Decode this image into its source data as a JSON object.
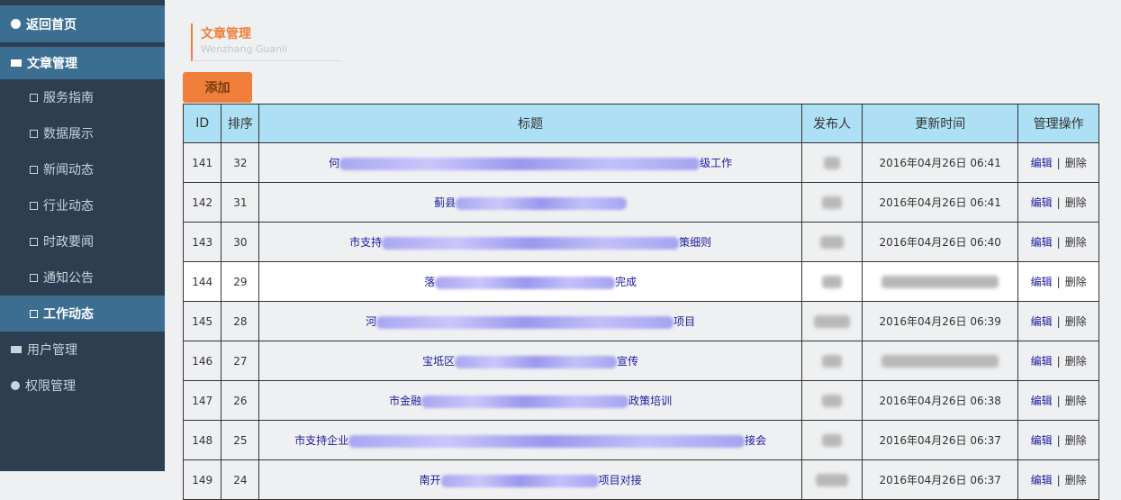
{
  "sidebar": {
    "home": "返回首页",
    "article_section": "文章管理",
    "items": [
      {
        "label": "服务指南",
        "active": false
      },
      {
        "label": "数据展示",
        "active": false
      },
      {
        "label": "新闻动态",
        "active": false
      },
      {
        "label": "行业动态",
        "active": false
      },
      {
        "label": "时政要闻",
        "active": false
      },
      {
        "label": "通知公告",
        "active": false
      },
      {
        "label": "工作动态",
        "active": true
      }
    ],
    "user_mgmt": "用户管理",
    "perm_mgmt": "权限管理"
  },
  "header": {
    "title": "文章管理",
    "subtitle": "Wenzhang Guanli"
  },
  "toolbar": {
    "add_label": "添加"
  },
  "table": {
    "columns": [
      "ID",
      "排序",
      "标题",
      "发布人",
      "更新时间",
      "管理操作"
    ],
    "edit_label": "编辑",
    "sep": "|",
    "delete_label": "删除",
    "rows": [
      {
        "id": "141",
        "sort": "32",
        "title_start": "何",
        "title_end": "级工作",
        "time": "2016年04月26日 06:41"
      },
      {
        "id": "142",
        "sort": "31",
        "title_start": "蓟县",
        "title_end": "",
        "time": "2016年04月26日 06:41"
      },
      {
        "id": "143",
        "sort": "30",
        "title_start": "市支持",
        "title_end": "策细则",
        "time": "2016年04月26日 06:40"
      },
      {
        "id": "144",
        "sort": "29",
        "title_start": "落",
        "title_end": "完成",
        "time": ""
      },
      {
        "id": "145",
        "sort": "28",
        "title_start": "河",
        "title_end": "项目",
        "time": "2016年04月26日 06:39"
      },
      {
        "id": "146",
        "sort": "27",
        "title_start": "宝坻区",
        "title_end": "宣传",
        "time": ""
      },
      {
        "id": "147",
        "sort": "26",
        "title_start": "市金融",
        "title_end": "政策培训",
        "time": "2016年04月26日 06:38"
      },
      {
        "id": "148",
        "sort": "25",
        "title_start": "市支持企业",
        "title_end": "接会",
        "time": "2016年04月26日 06:37"
      },
      {
        "id": "149",
        "sort": "24",
        "title_start": "南开",
        "title_end": "项目对接",
        "time": "2016年04月26日 06:37"
      }
    ]
  }
}
